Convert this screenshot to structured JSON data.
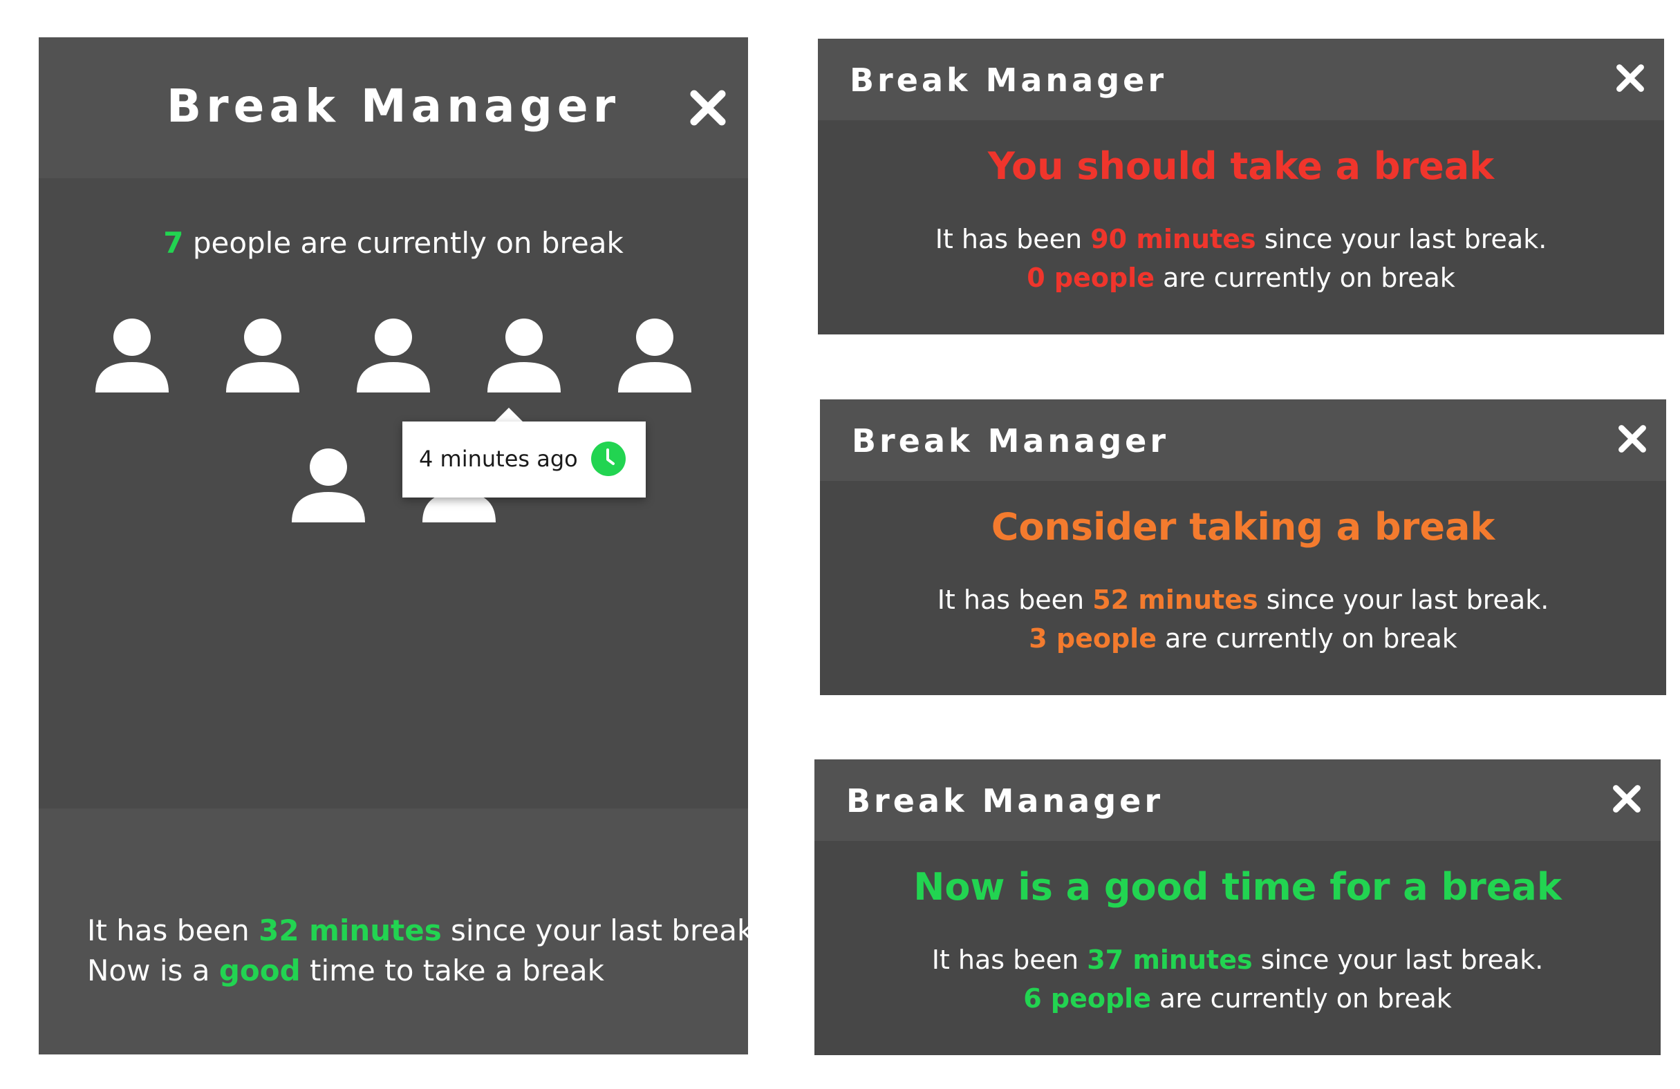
{
  "big_panel": {
    "title": "Break Manager",
    "close_icon": "close-icon",
    "people_count": "7",
    "people_text": " people are currently on break",
    "tooltip": {
      "text": "4 minutes ago",
      "icon": "clock-icon"
    },
    "footer": {
      "line1_prefix": "It has been ",
      "minutes": "32 minutes",
      "line1_suffix": " since your last break!",
      "line2_prefix": "Now is a ",
      "good": "good",
      "line2_suffix": " time to take a break"
    }
  },
  "cards": [
    {
      "title": "Break Manager",
      "headline": "You should take a break",
      "line1_prefix": "It has been ",
      "minutes": "90 minutes",
      "line1_suffix": " since your last break.",
      "people": "0 people",
      "line2_suffix": " are currently on break",
      "accent": "#f0352c"
    },
    {
      "title": "Break Manager",
      "headline": "Consider taking a break",
      "line1_prefix": "It has been ",
      "minutes": "52 minutes",
      "line1_suffix": " since your last break.",
      "people": "3 people",
      "line2_suffix": " are currently on break",
      "accent": "#f47b2e"
    },
    {
      "title": "Break Manager",
      "headline": "Now is a good time for a break",
      "line1_prefix": "It has been ",
      "minutes": "37 minutes",
      "line1_suffix": " since your last break.",
      "people": "6 people",
      "line2_suffix": " are currently on break",
      "accent": "#22d451"
    }
  ],
  "colors": {
    "panel_bg": "#4a4a4a",
    "header_bg": "#525252",
    "good_green": "#22d451",
    "warn_orange": "#f47b2e",
    "alert_red": "#f0352c"
  }
}
